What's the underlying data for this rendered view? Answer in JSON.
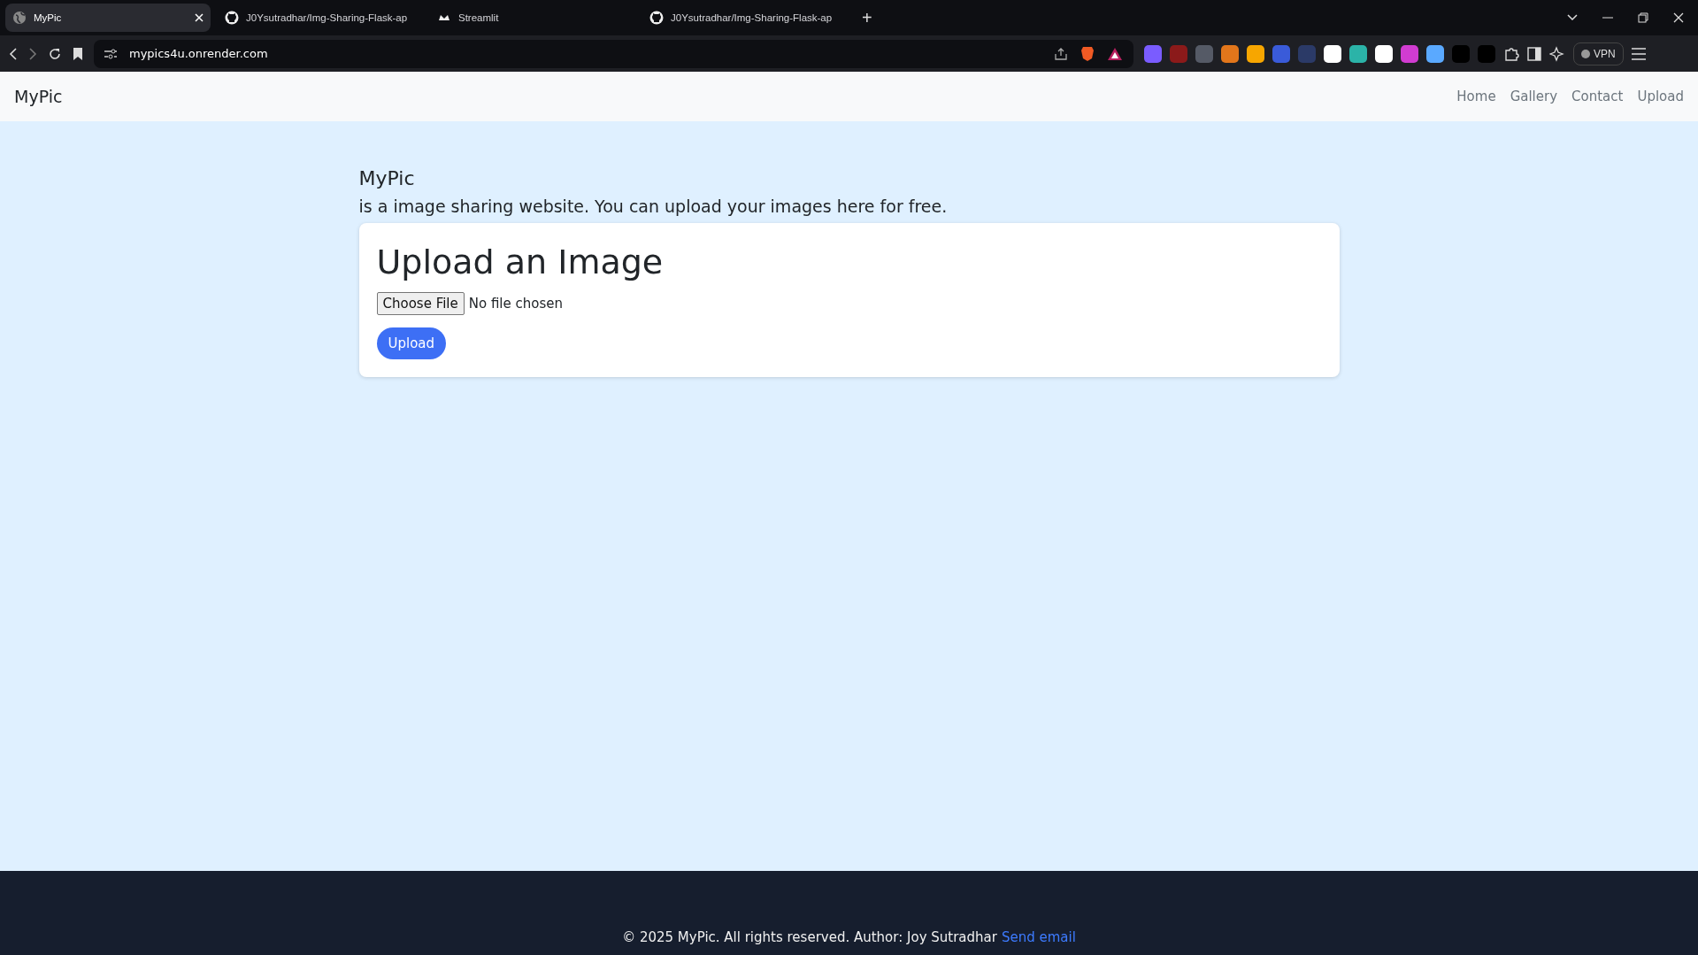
{
  "browser": {
    "tabs": [
      {
        "title": "MyPic",
        "selected": true,
        "kind": "globe"
      },
      {
        "title": "J0Ysutradhar/Img-Sharing-Flask-ap",
        "selected": false,
        "kind": "github"
      },
      {
        "title": "Streamlit",
        "selected": false,
        "kind": "streamlit"
      },
      {
        "title": "J0Ysutradhar/Img-Sharing-Flask-ap",
        "selected": false,
        "kind": "github"
      }
    ],
    "new_tab": "+",
    "url": "mypics4u.onrender.com",
    "vpn": "VPN"
  },
  "navbar": {
    "brand": "MyPic",
    "links": [
      "Home",
      "Gallery",
      "Contact",
      "Upload"
    ]
  },
  "main": {
    "title": "MyPic",
    "subtitle": "is a image sharing website. You can upload your images here for free.",
    "card": {
      "heading": "Upload an Image",
      "choose_button": "Choose File",
      "file_status": "No file chosen",
      "submit": "Upload"
    }
  },
  "footer": {
    "text": "© 2025 MyPic. All rights reserved. Author: Joy Sutradhar",
    "link": "Send email"
  }
}
